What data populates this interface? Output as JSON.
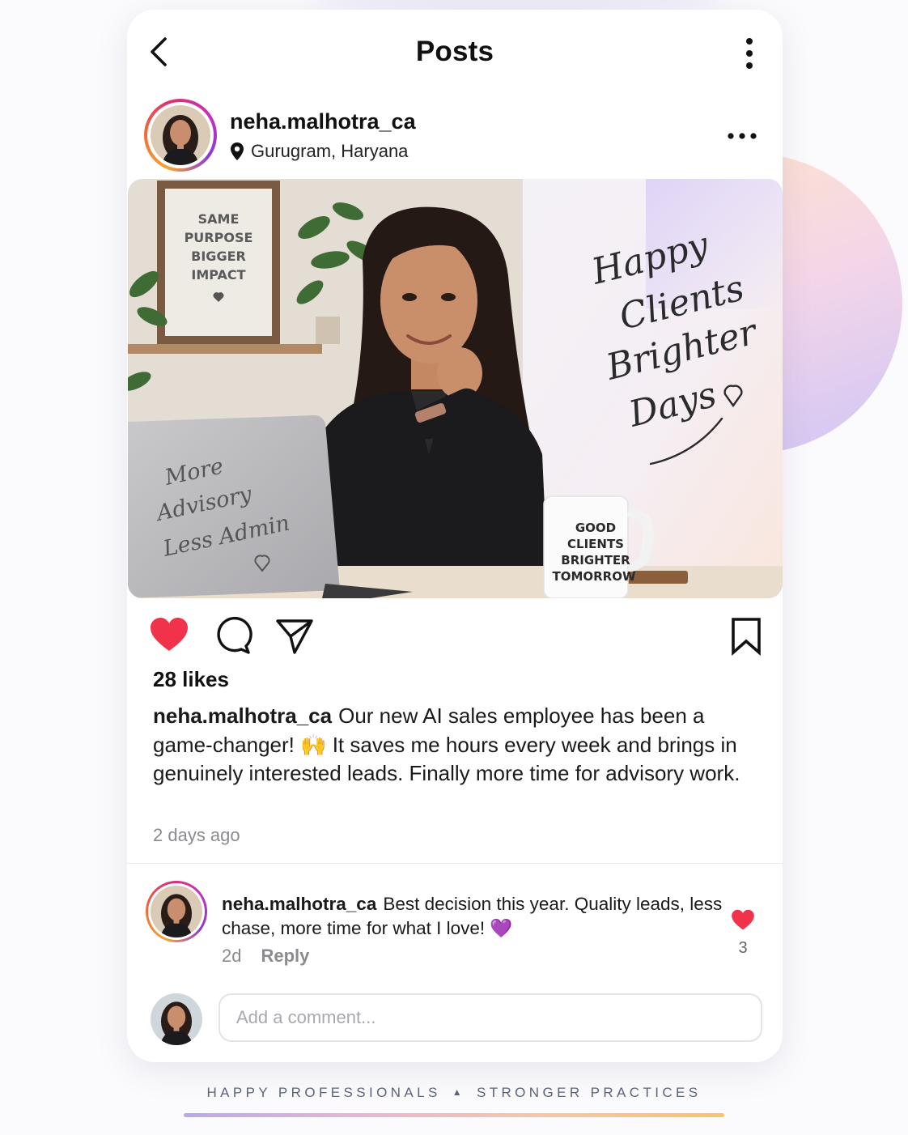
{
  "header": {
    "title": "Posts",
    "back_icon": "chevron-left-icon",
    "menu_icon": "vertical-dots-icon"
  },
  "post": {
    "username": "neha.malhotra_ca",
    "location": "Gurugram, Haryana",
    "location_icon": "map-pin-icon",
    "more_icon": "horizontal-dots-icon",
    "image": {
      "frame_text": [
        "SAME",
        "PURPOSE",
        "BIGGER",
        "IMPACT"
      ],
      "wall_handwriting": [
        "Happy",
        "Clients",
        "Brighter",
        "Days"
      ],
      "laptop_handwriting": [
        "More",
        "Advisory",
        "Less Admin"
      ],
      "mug_text": [
        "GOOD",
        "CLIENTS",
        "BRIGHTER",
        "TOMORROW"
      ]
    },
    "actions": {
      "like_icon": "heart-filled-icon",
      "comment_icon": "speech-bubble-icon",
      "share_icon": "paper-plane-icon",
      "save_icon": "bookmark-icon",
      "liked": true
    },
    "likes_text": "28 likes",
    "caption_user": "neha.malhotra_ca",
    "caption_text": "Our new AI sales employee has been a game-changer! 🙌 It saves me hours every week and brings in genuinely interested leads. Finally more time for advisory work.",
    "time_ago": "2 days ago"
  },
  "comment": {
    "username": "neha.malhotra_ca",
    "text": "Best decision this year. Quality leads, less chase, more time for what I love! 💜",
    "age": "2d",
    "reply_label": "Reply",
    "like_count": "3"
  },
  "composer": {
    "placeholder": "Add a comment..."
  },
  "footer": {
    "tagline_left": "HAPPY PROFESSIONALS",
    "tagline_sep": "▲",
    "tagline_right": "STRONGER PRACTICES"
  },
  "colors": {
    "like_red": "#f0334a",
    "text_muted": "#8a8a8f",
    "accent_gradient": [
      "#b8a9ea",
      "#f7c36e"
    ]
  }
}
